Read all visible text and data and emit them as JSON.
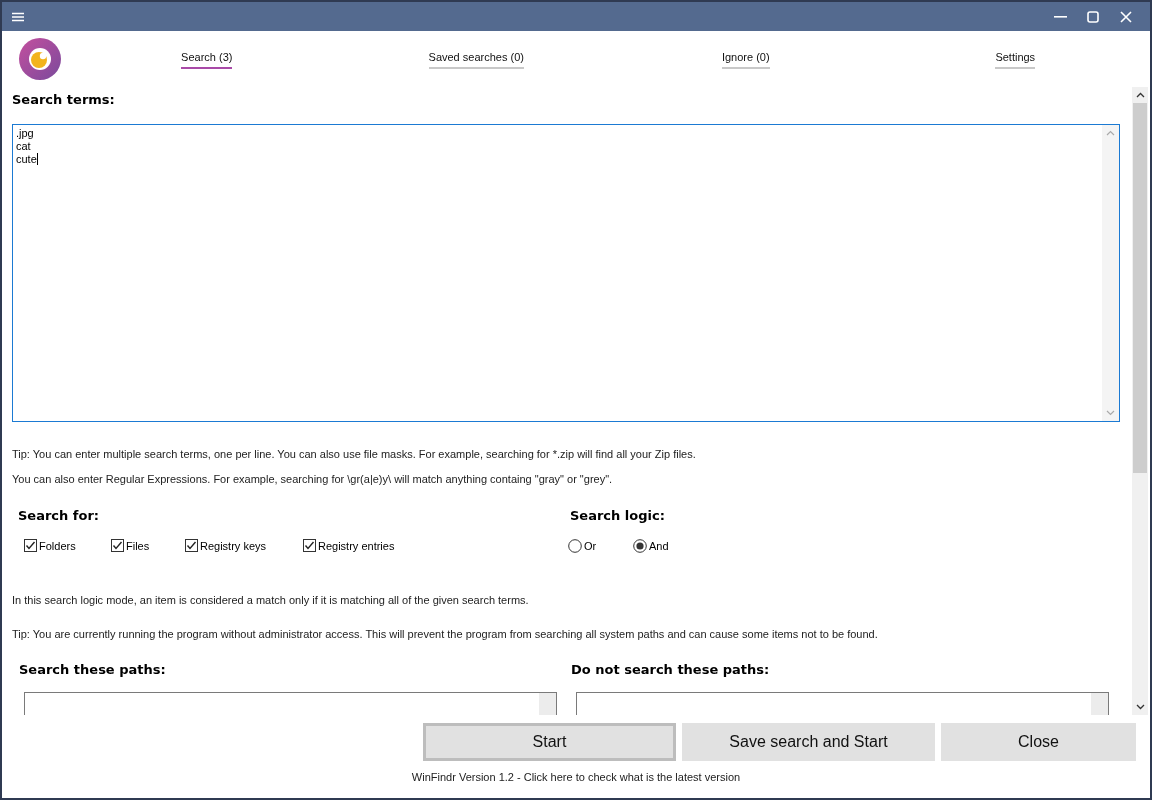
{
  "tabs": [
    {
      "label": "Search (3)",
      "selected": true
    },
    {
      "label": "Saved searches (0)",
      "selected": false
    },
    {
      "label": "Ignore (0)",
      "selected": false
    },
    {
      "label": "Settings",
      "selected": false
    }
  ],
  "search_terms": {
    "label": "Search terms:",
    "lines": [
      ".jpg",
      "cat",
      "cute"
    ]
  },
  "tips": [
    "Tip: You can enter multiple search terms, one per line. You can also use file masks. For example, searching for *.zip will find all your Zip files.",
    "You can also enter Regular Expressions. For example, searching for \\gr(a|e)y\\ will match anything containg \"gray\" or \"grey\"."
  ],
  "search_for": {
    "label": "Search for:",
    "options": [
      {
        "label": "Folders",
        "checked": true
      },
      {
        "label": "Files",
        "checked": true
      },
      {
        "label": "Registry keys",
        "checked": true
      },
      {
        "label": "Registry entries",
        "checked": true
      }
    ]
  },
  "search_logic": {
    "label": "Search logic:",
    "options": [
      {
        "label": "Or",
        "selected": false
      },
      {
        "label": "And",
        "selected": true
      }
    ]
  },
  "mode_info": "In this search logic mode, an item is considered a match only if it is matching all of the given search terms.",
  "admin_tip": "Tip: You are currently running the program without administrator access. This will prevent the program from searching all system paths and can cause some items not to be found.",
  "paths": [
    {
      "label": "Search these paths:"
    },
    {
      "label": "Do not search these paths:"
    }
  ],
  "buttons": [
    {
      "label": "Start",
      "focused": true
    },
    {
      "label": "Save search and Start",
      "focused": false
    },
    {
      "label": "Close",
      "focused": false
    }
  ],
  "version_text": "WinFindr Version 1.2 - Click here to check what is the latest version"
}
